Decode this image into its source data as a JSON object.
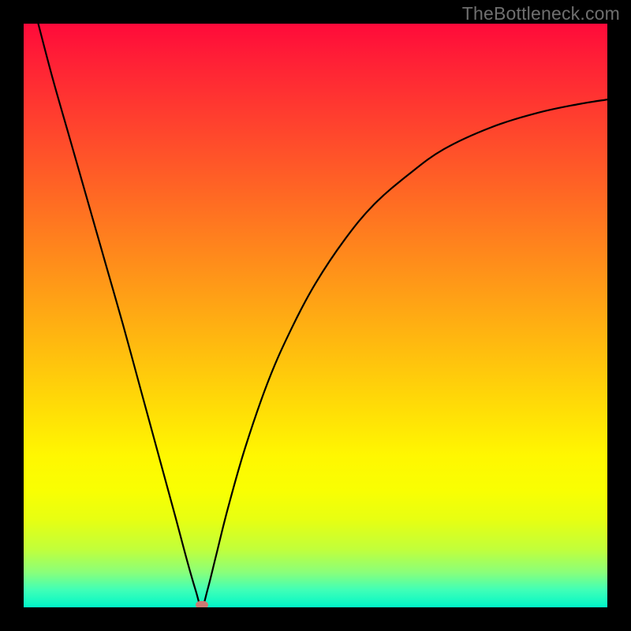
{
  "watermark": "TheBottleneck.com",
  "colors": {
    "frame": "#000000",
    "curve": "#000000",
    "marker": "#cd7a74"
  },
  "chart_data": {
    "type": "line",
    "title": "",
    "xlabel": "",
    "ylabel": "",
    "xlim": [
      0,
      1
    ],
    "ylim": [
      0,
      1
    ],
    "min_point": {
      "x": 0.305,
      "y": 0.0
    },
    "series": [
      {
        "name": "bottleneck-curve",
        "x": [
          0.025,
          0.05,
          0.08,
          0.11,
          0.14,
          0.17,
          0.2,
          0.23,
          0.26,
          0.28,
          0.295,
          0.305,
          0.315,
          0.33,
          0.35,
          0.38,
          0.42,
          0.46,
          0.5,
          0.55,
          0.6,
          0.66,
          0.72,
          0.8,
          0.88,
          0.95,
          1.0
        ],
        "y": [
          1.0,
          0.905,
          0.8,
          0.695,
          0.59,
          0.485,
          0.375,
          0.265,
          0.155,
          0.08,
          0.028,
          0.0,
          0.03,
          0.09,
          0.17,
          0.275,
          0.39,
          0.48,
          0.555,
          0.63,
          0.69,
          0.742,
          0.785,
          0.822,
          0.847,
          0.862,
          0.87
        ]
      }
    ],
    "gradient_stops": [
      {
        "pos": 0.0,
        "color": "#ff0a3a"
      },
      {
        "pos": 0.24,
        "color": "#ff5728"
      },
      {
        "pos": 0.54,
        "color": "#ffb710"
      },
      {
        "pos": 0.8,
        "color": "#f9ff02"
      },
      {
        "pos": 1.0,
        "color": "#00f7c8"
      }
    ]
  }
}
